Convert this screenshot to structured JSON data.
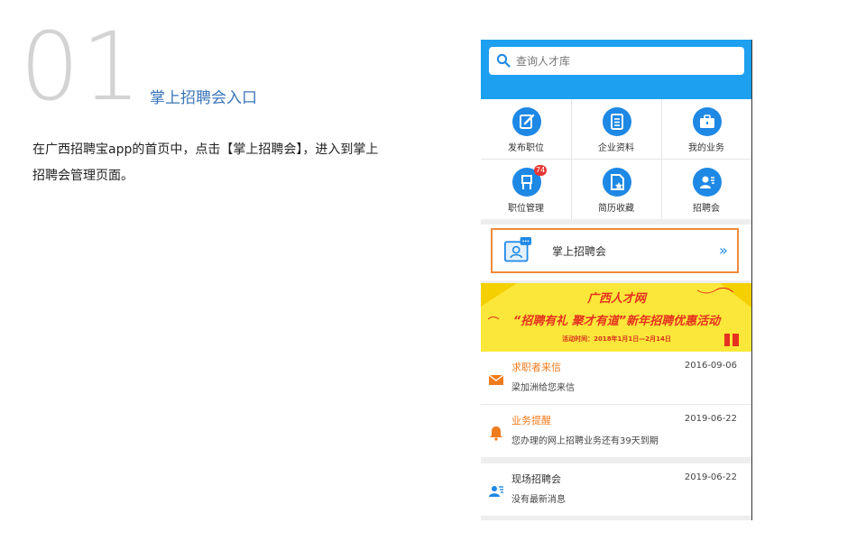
{
  "slide": {
    "number": "01",
    "title": "掌上招聘会入口",
    "description": "在广西招聘宝app的首页中，点击【掌上招聘会】，进入到掌上招聘会管理页面。"
  },
  "app": {
    "search": {
      "placeholder": "查询人才库",
      "icon": "search-icon"
    },
    "grid": [
      {
        "label": "发布职位",
        "icon": "edit-icon"
      },
      {
        "label": "企业资料",
        "icon": "clipboard-icon"
      },
      {
        "label": "我的业务",
        "icon": "briefcase-icon"
      },
      {
        "label": "职位管理",
        "icon": "chair-icon",
        "badge": "74"
      },
      {
        "label": "简历收藏",
        "icon": "star-document-icon"
      },
      {
        "label": "招聘会",
        "icon": "person-list-icon"
      }
    ],
    "job_fair_entry": {
      "label": "掌上招聘会",
      "icon": "chat-profile-icon",
      "arrow": "»"
    },
    "promo_banner": {
      "line1": "广西人才网",
      "line2": "“招聘有礼 聚才有道”新年招聘优惠活动",
      "line3": "活动时间：2018年1月1日—2月14日"
    },
    "messages": [
      {
        "title": "求职者来信",
        "subtitle": "梁加洲给您来信",
        "date": "2016-09-06",
        "icon": "envelope-icon",
        "title_color": "#f07b1d"
      },
      {
        "title": "业务提醒",
        "subtitle": "您办理的网上招聘业务还有39天到期",
        "date": "2019-06-22",
        "icon": "bell-icon",
        "title_color": "#f07b1d"
      },
      {
        "title": "现场招聘会",
        "subtitle": "没有最新消息",
        "date": "2019-06-22",
        "icon": "person-list-icon",
        "title_color": "#333333"
      }
    ],
    "colors": {
      "header_blue": "#1ea0f0",
      "icon_blue": "#1e88e5",
      "accent_orange": "#f08a3c",
      "banner_yellow": "#fbe73a",
      "banner_red": "#e5311f"
    }
  }
}
